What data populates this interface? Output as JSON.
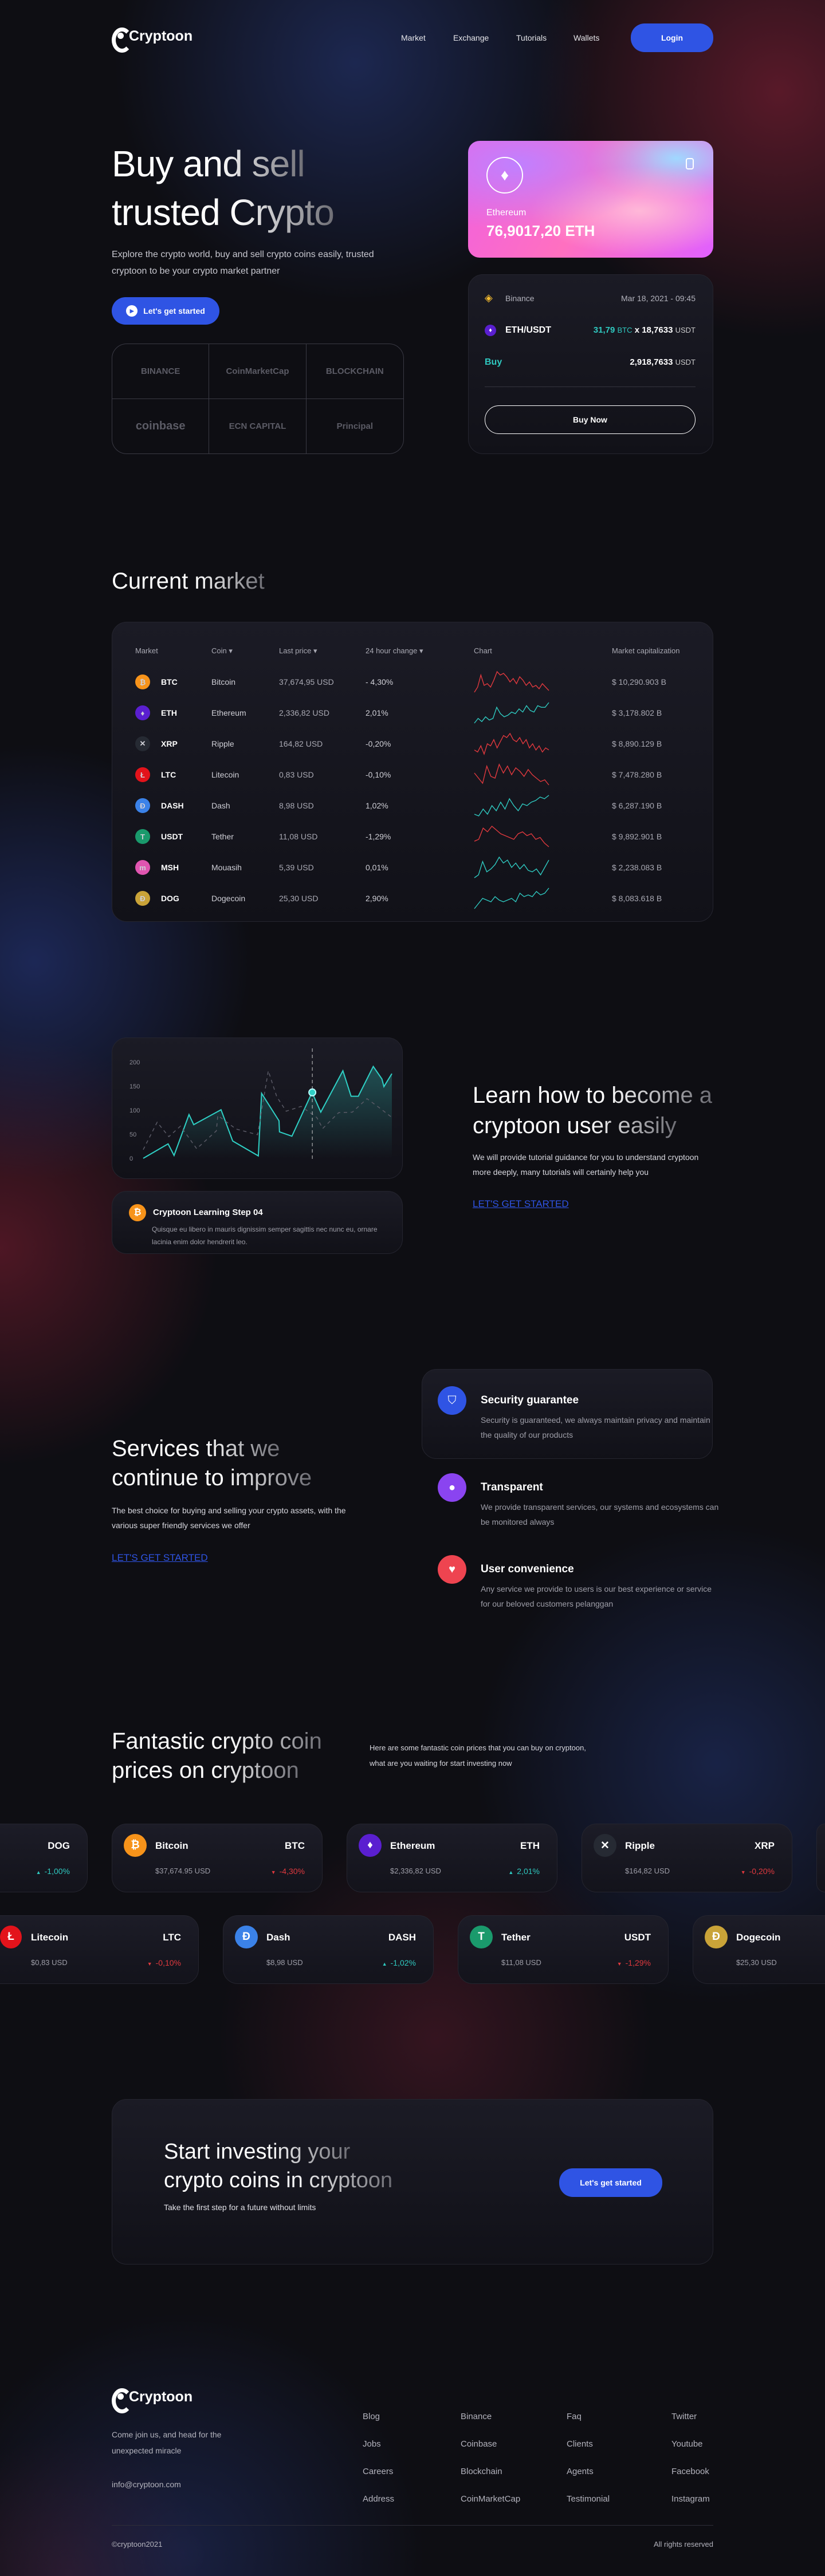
{
  "header": {
    "brand": "Cryptoon",
    "nav": [
      "Market",
      "Exchange",
      "Tutorials",
      "Wallets"
    ],
    "login": "Login"
  },
  "hero": {
    "title_line1": "Buy and sell",
    "title_line2": "trusted Crypto",
    "description": "Explore the crypto world, buy and sell crypto coins easily, trusted cryptoon to be your crypto market partner",
    "cta": "Let's get started",
    "partners": [
      "BINANCE",
      "CoinMarketCap",
      "BLOCKCHAIN",
      "coinbase",
      "ECN CAPITAL",
      "Principal"
    ]
  },
  "wallet_card": {
    "coin": "Ethereum",
    "amount": "76,9017,20 ETH"
  },
  "trade": {
    "exchange": "Binance",
    "datetime": "Mar 18, 2021 - 09:45",
    "pair": "ETH/USDT",
    "qty": "31,79",
    "qty_unit": "BTC",
    "times": "x",
    "rate": "18,7633",
    "rate_unit": "USDT",
    "side": "Buy",
    "total": "2,918,7633",
    "total_unit": "USDT",
    "button": "Buy Now"
  },
  "market": {
    "title": "Current market",
    "headers": {
      "market": "Market",
      "coin": "Coin",
      "last_price": "Last price",
      "change": "24 hour change",
      "chart": "Chart",
      "cap": "Market capitalization"
    },
    "rows": [
      {
        "symbol": "BTC",
        "name": "Bitcoin",
        "price": "37,674,95 USD",
        "change": "- 4,30%",
        "dir": "down",
        "cap": "$ 10,290.903 B",
        "color": "#f7931a",
        "glyph": "₿",
        "spark": [
          2,
          5,
          12,
          6,
          7,
          5,
          9,
          14,
          12,
          13,
          11,
          8,
          10,
          7,
          11,
          9,
          6,
          8,
          5,
          6,
          4,
          7,
          5,
          3
        ]
      },
      {
        "symbol": "ETH",
        "name": "Ethereum",
        "price": "2,336,82 USD",
        "change": "2,01%",
        "dir": "up",
        "cap": "$ 3,178.802 B",
        "color": "#5a1fd0",
        "glyph": "♦",
        "spark": [
          2,
          5,
          3,
          6,
          4,
          5,
          12,
          8,
          6,
          7,
          9,
          8,
          11,
          9,
          13,
          10,
          9,
          13,
          12,
          12,
          15
        ]
      },
      {
        "symbol": "XRP",
        "name": "Ripple",
        "price": "164,82 USD",
        "change": "-0,20%",
        "dir": "down",
        "cap": "$ 8,890.129 B",
        "color": "#262a33",
        "glyph": "✕",
        "spark": [
          5,
          4,
          7,
          3,
          8,
          7,
          10,
          6,
          9,
          12,
          11,
          13,
          10,
          9,
          11,
          8,
          10,
          6,
          8,
          5,
          7,
          4,
          6,
          5
        ]
      },
      {
        "symbol": "LTC",
        "name": "Litecoin",
        "price": "0,83 USD",
        "change": "-0,10%",
        "dir": "down",
        "cap": "$ 7,478.280 B",
        "color": "#e3131b",
        "glyph": "Ł",
        "spark": [
          10,
          7,
          4,
          14,
          8,
          7,
          15,
          10,
          14,
          9,
          13,
          11,
          8,
          12,
          9,
          7,
          5,
          6,
          3
        ]
      },
      {
        "symbol": "DASH",
        "name": "Dash",
        "price": "8,98 USD",
        "change": "1,02%",
        "dir": "up",
        "cap": "$ 6,287.190 B",
        "color": "#3b82e8",
        "glyph": "Đ",
        "spark": [
          3,
          2,
          6,
          3,
          8,
          5,
          10,
          6,
          12,
          8,
          5,
          9,
          8,
          10,
          11,
          13,
          12,
          14
        ]
      },
      {
        "symbol": "USDT",
        "name": "Tether",
        "price": "11,08 USD",
        "change": "-1,29%",
        "dir": "down",
        "cap": "$ 9,892.901 B",
        "color": "#1a9a6c",
        "glyph": "T",
        "spark": [
          6,
          7,
          13,
          11,
          14,
          12,
          10,
          9,
          8,
          7,
          10,
          11,
          9,
          10,
          7,
          8,
          5,
          3
        ]
      },
      {
        "symbol": "MSH",
        "name": "Mouasih",
        "price": "5,39 USD",
        "change": "0,01%",
        "dir": "up",
        "cap": "$ 2,238.083 B",
        "color": "#e055b0",
        "glyph": "m",
        "spark": [
          2,
          4,
          13,
          6,
          8,
          11,
          16,
          12,
          14,
          9,
          12,
          8,
          11,
          7,
          6,
          8,
          4,
          9,
          14
        ]
      },
      {
        "symbol": "DOG",
        "name": "Dogecoin",
        "price": "25,30 USD",
        "change": "2,90%",
        "dir": "up",
        "cap": "$ 8,083.618 B",
        "color": "#c9a338",
        "glyph": "Ð",
        "spark": [
          2,
          5,
          8,
          7,
          6,
          9,
          7,
          6,
          7,
          8,
          6,
          11,
          9,
          10,
          9,
          12,
          10,
          11,
          14
        ]
      }
    ]
  },
  "learn": {
    "title_line1": "Learn how to become a",
    "title_line2": "cryptoon user easily",
    "description": "We will provide tutorial guidance for you to understand cryptoon more deeply, many tutorials will certainly help you",
    "link": "LET'S GET STARTED",
    "step_title": "Cryptoon Learning Step 04",
    "step_text": "Quisque eu libero in mauris dignissim semper sagittis nec nunc eu, ornare lacinia enim dolor hendrerit leo."
  },
  "chart_data": {
    "type": "line",
    "yticks": [
      "200",
      "150",
      "100",
      "50",
      "0"
    ],
    "ylim": [
      0,
      200
    ],
    "xlim": [
      0,
      100
    ],
    "highlight_x": 68,
    "series": [
      {
        "name": "main",
        "style": "solid",
        "color": "#2fd0c5",
        "x": [
          0,
          10,
          12.4,
          18.4,
          20.3,
          31.3,
          36,
          46.3,
          47.6,
          54.6,
          54.8,
          59.8,
          67.9,
          71.4,
          80.3,
          83.6,
          86.5,
          92.5,
          96,
          96.8,
          100
        ],
        "y": [
          0,
          30,
          6,
          91,
          70,
          101,
          36,
          5,
          135,
          78,
          55,
          46,
          137,
          96,
          182,
          129,
          129,
          191,
          165,
          149,
          176
        ]
      },
      {
        "name": "previous",
        "style": "dashed",
        "color": "#5a5a66",
        "x": [
          0,
          5.6,
          10.3,
          15,
          21.5,
          29.4,
          30,
          37.3,
          46,
          50.3,
          53.7,
          57.5,
          63.5,
          69.8,
          72.2,
          78.6,
          84.1,
          90,
          95,
          100
        ],
        "y": [
          18,
          75,
          45,
          67,
          20,
          57,
          89,
          61,
          49,
          182,
          128,
          98,
          108,
          85,
          62,
          95,
          96,
          124,
          105,
          85
        ]
      }
    ]
  },
  "services": {
    "title_line1": "Services that we",
    "title_line2": "continue to improve",
    "description": "The best choice for buying and selling your crypto assets, with the various super friendly services we offer",
    "link": "LET'S GET STARTED",
    "items": [
      {
        "title": "Security guarantee",
        "text": "Security is guaranteed, we always maintain privacy and maintain the quality of our products",
        "color": "#2f54e4",
        "icon": "shield-icon",
        "glyph": "⛉"
      },
      {
        "title": "Transparent",
        "text": "We provide transparent services, our systems and ecosystems can be monitored always",
        "color": "#8a44f0",
        "icon": "magnifier-icon",
        "glyph": "●"
      },
      {
        "title": "User convenience",
        "text": "Any service we provide to users is our best experience or service for our beloved customers pelanggan",
        "color": "#ee4450",
        "icon": "heart-icon",
        "glyph": "♥"
      }
    ]
  },
  "prices": {
    "title_line1": "Fantastic crypto coin",
    "title_line2": "prices on cryptoon",
    "description": "Here are some fantastic coin prices that you can buy on cryptoon, what are you waiting for start investing now",
    "row1": [
      {
        "symbol": "DOG",
        "change": "-1,00%",
        "dir": "up",
        "partial": true,
        "color": "#c9a338",
        "glyph": "Ð"
      },
      {
        "name": "Bitcoin",
        "symbol": "BTC",
        "price": "$37,674.95 USD",
        "change": "-4,30%",
        "dir": "down",
        "color": "#f7931a",
        "glyph": "₿"
      },
      {
        "name": "Ethereum",
        "symbol": "ETH",
        "price": "$2,336,82 USD",
        "change": "2,01%",
        "dir": "up",
        "color": "#5a1fd0",
        "glyph": "♦"
      },
      {
        "name": "Ripple",
        "symbol": "XRP",
        "price": "$164,82 USD",
        "change": "-0,20%",
        "dir": "down",
        "color": "#262a33",
        "glyph": "✕"
      },
      {
        "empty": true
      }
    ],
    "row2": [
      {
        "name": "Litecoin",
        "symbol": "LTC",
        "price": "$0,83 USD",
        "change": "-0,10%",
        "dir": "down",
        "color": "#e3131b",
        "glyph": "Ł"
      },
      {
        "name": "Dash",
        "symbol": "DASH",
        "price": "$8,98 USD",
        "change": "-1,02%",
        "dir": "up",
        "color": "#3b82e8",
        "glyph": "Đ"
      },
      {
        "name": "Tether",
        "symbol": "USDT",
        "price": "$11,08 USD",
        "change": "-1,29%",
        "dir": "down",
        "color": "#1a9a6c",
        "glyph": "T"
      },
      {
        "name": "Dogecoin",
        "price": "$25,30 USD",
        "color": "#c9a338",
        "glyph": "Ð"
      }
    ]
  },
  "cta": {
    "title_line1": "Start investing your",
    "title_line2": "crypto coins in cryptoon",
    "subtitle": "Take the first step for a future without limits",
    "button": "Let's get started"
  },
  "footer": {
    "brand": "Cryptoon",
    "tagline": "Come join us, and head for the unexpected miracle",
    "email": "info@cryptoon.com",
    "columns": [
      [
        "Blog",
        "Jobs",
        "Careers",
        "Address"
      ],
      [
        "Binance",
        "Coinbase",
        "Blockchain",
        "CoinMarketCap"
      ],
      [
        "Faq",
        "Clients",
        "Agents",
        "Testimonial"
      ],
      [
        "Twitter",
        "Youtube",
        "Facebook",
        "Instagram"
      ]
    ],
    "copyright": "©cryptoon2021",
    "rights": "All rights reserved"
  },
  "colors": {
    "accent": "#2f54e4",
    "up": "#2fc9c0",
    "down": "#e0393e"
  }
}
